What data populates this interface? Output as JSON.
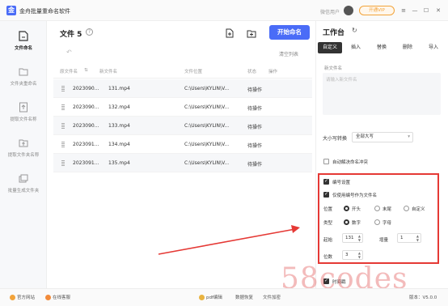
{
  "window": {
    "logo_text": "金",
    "app_title": "金舟批量重命名软件",
    "user_label": "微信用户",
    "vip_label": "开通VIP",
    "controls": {
      "menu": "≡",
      "minimize": "—",
      "maximize": "☐",
      "close": "✕"
    }
  },
  "sidebar": {
    "items": [
      {
        "label": "文件命名",
        "icon": "file-rename-icon",
        "active": true
      },
      {
        "label": "文件夹重命名",
        "icon": "folder-rename-icon"
      },
      {
        "label": "提取文件名称",
        "icon": "extract-name-icon"
      },
      {
        "label": "提取文件夹名称",
        "icon": "extract-folder-icon"
      },
      {
        "label": "批量生成文件夹",
        "icon": "batch-folder-icon"
      }
    ]
  },
  "main": {
    "title": "文件 5",
    "help": "?",
    "start_button": "开始命名",
    "clear_list": "清空列表",
    "undo": "↶",
    "columns": [
      "原文件名",
      "新文件名",
      "文件位置",
      "状态",
      "操作"
    ],
    "rows": [
      {
        "orig": "2023090...",
        "new": "131.mp4",
        "path": "C:\\Users\\KYLIN\\V...",
        "status": "待操作"
      },
      {
        "orig": "2023090...",
        "new": "132.mp4",
        "path": "C:\\Users\\KYLIN\\V...",
        "status": "待操作"
      },
      {
        "orig": "2023090...",
        "new": "133.mp4",
        "path": "C:\\Users\\KYLIN\\V...",
        "status": "待操作"
      },
      {
        "orig": "2023091...",
        "new": "134.mp4",
        "path": "C:\\Users\\KYLIN\\V...",
        "status": "待操作"
      },
      {
        "orig": "2023091...",
        "new": "135.mp4",
        "path": "C:\\Users\\KYLIN\\V...",
        "status": "待操作"
      }
    ]
  },
  "panel": {
    "title": "工作台",
    "refresh": "↻",
    "tabs": [
      "自定义",
      "插入",
      "替换",
      "删除",
      "导入"
    ],
    "new_name_label": "新文件名",
    "new_name_placeholder": "请输入新文件名",
    "case_label": "大小写转换",
    "case_value": "全部大写",
    "case_arrow": "▾",
    "auto_resolve": "自动解决命名冲突",
    "numbering": "编号设置",
    "use_number_only": "仅使用编号作为文件名",
    "position_label": "位置",
    "position_options": [
      "开头",
      "末尾",
      "自定义"
    ],
    "type_label": "类型",
    "type_options": [
      "数字",
      "字母"
    ],
    "start_label": "起始",
    "start_value": "131",
    "step_label": "增量",
    "step_value": "1",
    "digits_label": "位数",
    "digits_value": "3",
    "spin_up": "▲",
    "spin_down": "▼",
    "more_label": "时间戳"
  },
  "bottom": {
    "official": "官方网站",
    "service": "在线客服",
    "links": [
      "pdf编辑",
      "数据恢复",
      "文件加密"
    ],
    "version": "版本：V5.0.0"
  },
  "watermark": "58codes",
  "colors": {
    "accent": "#4a6cf7",
    "highlight": "#e53935"
  }
}
